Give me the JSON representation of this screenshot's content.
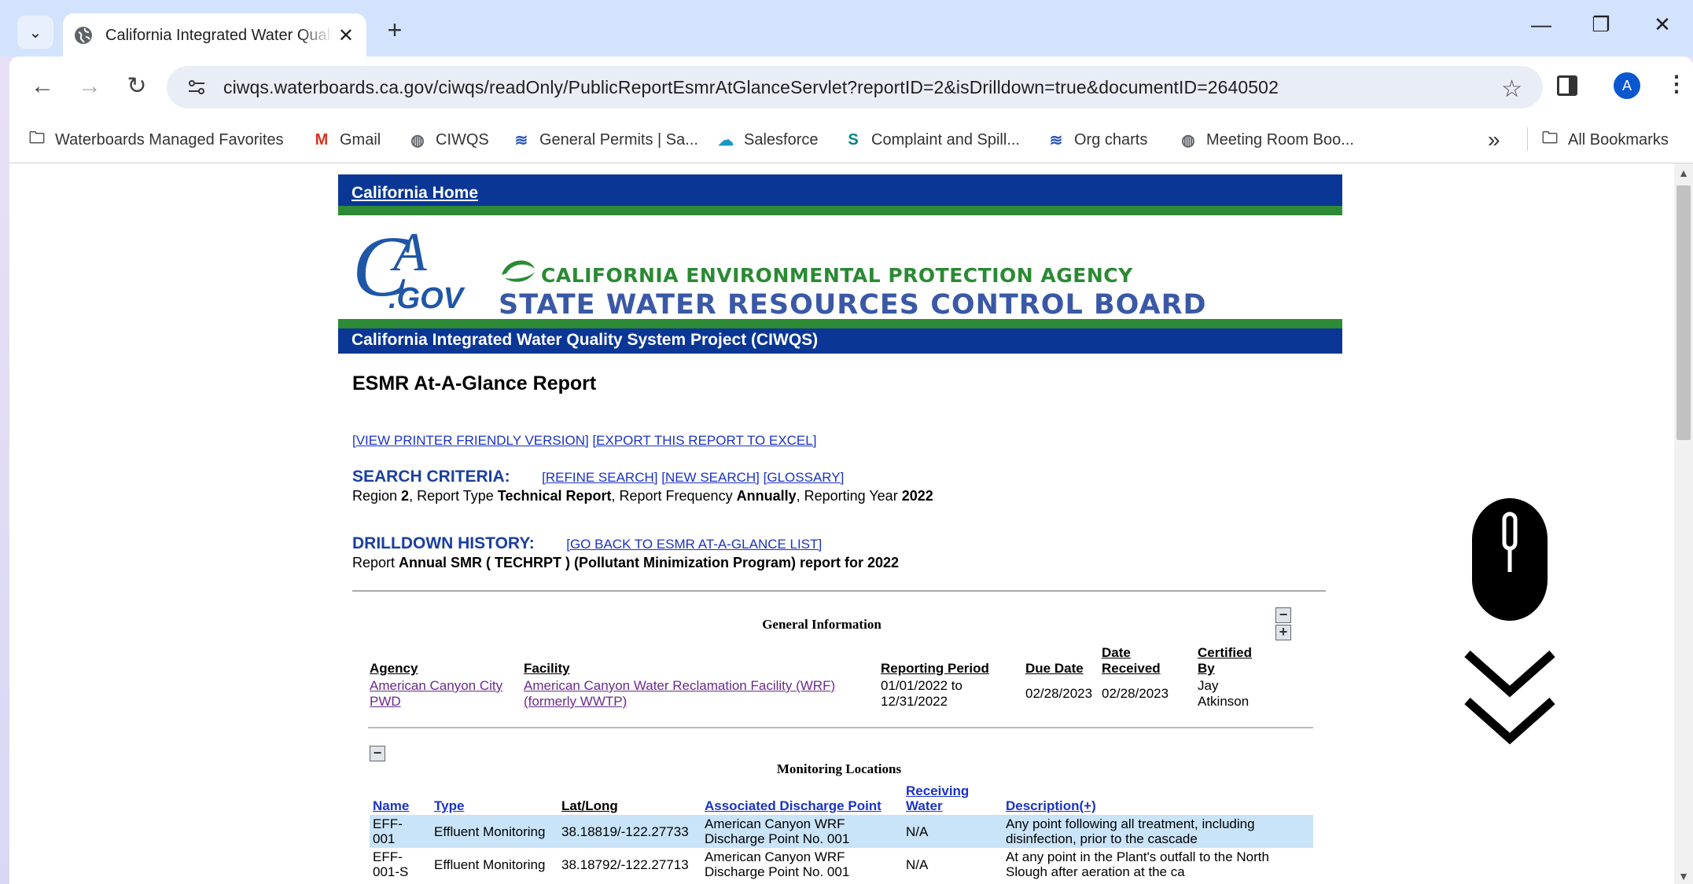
{
  "browser": {
    "tab_title": "California Integrated Water Quality System",
    "url": "ciwqs.waterboards.ca.gov/ciwqs/readOnly/PublicReportEsmrAtGlanceServlet?reportID=2&isDrilldown=true&documentID=2640502",
    "avatar_letter": "A",
    "bookmarks": [
      {
        "label": "Waterboards Managed Favorites",
        "icon": "managed-folder-icon"
      },
      {
        "label": "Gmail",
        "icon": "gmail-icon"
      },
      {
        "label": "CIWQS",
        "icon": "globe-icon"
      },
      {
        "label": "General Permits | Sa...",
        "icon": "waterboards-icon"
      },
      {
        "label": "Salesforce",
        "icon": "salesforce-icon"
      },
      {
        "label": "Complaint and Spill...",
        "icon": "sharepoint-icon"
      },
      {
        "label": "Org charts",
        "icon": "waterboards-icon"
      },
      {
        "label": "Meeting Room Boo...",
        "icon": "globe-icon"
      }
    ],
    "all_bookmarks_label": "All Bookmarks"
  },
  "header": {
    "ca_home": "California Home",
    "logo_text": "CA.GOV",
    "agency": "CALIFORNIA ENVIRONMENTAL PROTECTION AGENCY",
    "board": "STATE WATER RESOURCES CONTROL BOARD",
    "project": "California Integrated Water Quality System Project (CIWQS)"
  },
  "report": {
    "title": "ESMR At-A-Glance Report",
    "printer_link": "[VIEW PRINTER FRIENDLY VERSION]",
    "excel_link": "[EXPORT THIS REPORT TO EXCEL]",
    "search_criteria": {
      "heading": "SEARCH CRITERIA:",
      "refine": "[REFINE SEARCH]",
      "new": "[NEW SEARCH]",
      "glossary": "[GLOSSARY]",
      "parts": [
        {
          "text": "Region ",
          "bold": false
        },
        {
          "text": "2",
          "bold": true
        },
        {
          "text": ", Report Type ",
          "bold": false
        },
        {
          "text": "Technical Report",
          "bold": true
        },
        {
          "text": ", Report Frequency ",
          "bold": false
        },
        {
          "text": "Annually",
          "bold": true
        },
        {
          "text": ", Reporting Year ",
          "bold": false
        },
        {
          "text": "2022",
          "bold": true
        }
      ]
    },
    "drilldown": {
      "heading": "DRILLDOWN HISTORY:",
      "back": "[GO BACK TO ESMR AT-A-GLANCE LIST]",
      "prefix": "Report ",
      "report_name": "Annual SMR ( TECHRPT ) (Pollutant Minimization Program) report for 2022"
    }
  },
  "general_info": {
    "title": "General Information",
    "headers": {
      "agency": "Agency",
      "facility": "Facility",
      "period": "Reporting Period",
      "due": "Due Date",
      "received_1": "Date",
      "received_2": "Received",
      "certified_1": "Certified",
      "certified_2": "By"
    },
    "agency_1": "American Canyon City",
    "agency_2": "PWD",
    "facility_1": "American Canyon Water Reclamation Facility (WRF)",
    "facility_2": "(formerly WWTP)",
    "period_1": "01/01/2022 to",
    "period_2": "12/31/2022",
    "due": "02/28/2023",
    "received": "02/28/2023",
    "certified_1": "Jay",
    "certified_2": "Atkinson",
    "collapse_symbol": "−",
    "expand_symbol": "+"
  },
  "monitoring_locations": {
    "title": "Monitoring Locations",
    "collapse_symbol": "−",
    "headers": {
      "name": "Name",
      "type": "Type",
      "latlong": "Lat/Long",
      "discharge": "Associated Discharge Point",
      "receiving_1": "Receiving",
      "receiving_2": "Water",
      "description": "Description(+)"
    },
    "rows": [
      {
        "name_1": "EFF-",
        "name_2": "001",
        "type": "Effluent Monitoring",
        "latlong": "38.18819/-122.27733",
        "discharge_1": "American Canyon WRF",
        "discharge_2": "Discharge Point No. 001",
        "receiving": "N/A",
        "description_1": "Any point following all treatment, including",
        "description_2": "disinfection, prior to the cascade"
      },
      {
        "name_1": "EFF-",
        "name_2": "001-S",
        "type": "Effluent Monitoring",
        "latlong": "38.18792/-122.27713",
        "discharge_1": "American Canyon WRF",
        "discharge_2": "Discharge Point No. 001",
        "receiving": "N/A",
        "description_1": "At any point in the Plant's outfall to the North",
        "description_2": "Slough after aeration at the ca"
      }
    ]
  }
}
